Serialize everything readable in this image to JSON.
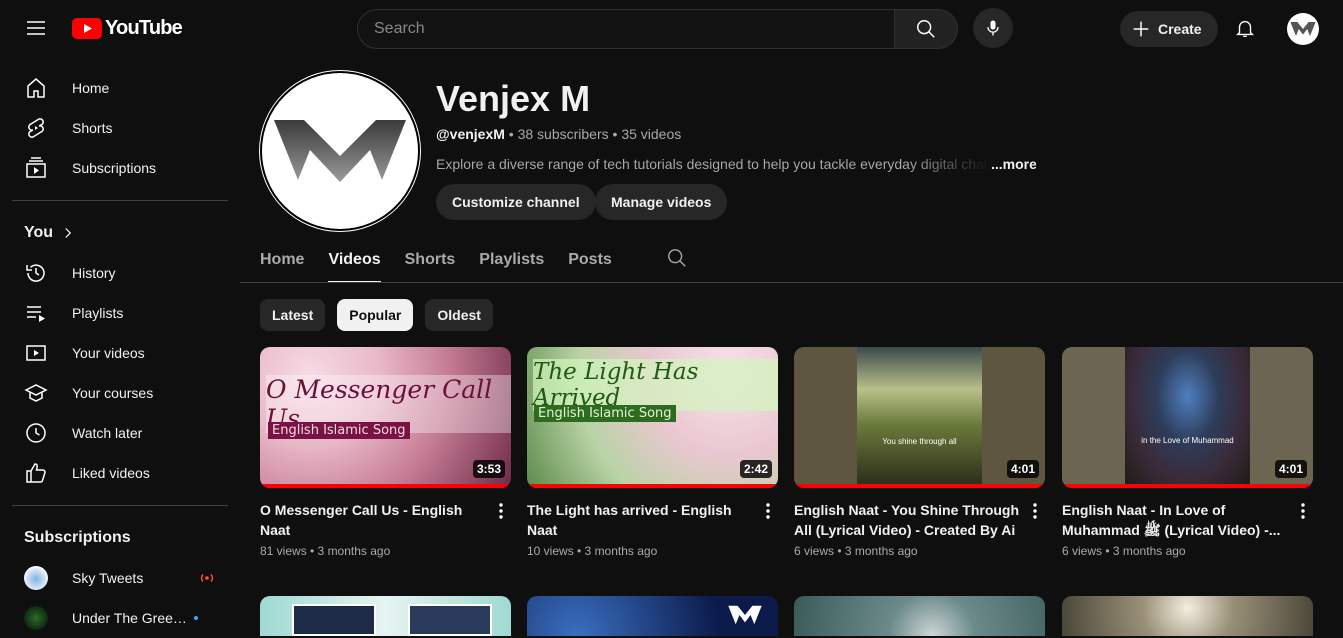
{
  "topbar": {
    "logo_text": "YouTube",
    "search_placeholder": "Search",
    "create_label": "Create"
  },
  "sidebar": {
    "main": [
      {
        "label": "Home",
        "icon": "home-icon"
      },
      {
        "label": "Shorts",
        "icon": "shorts-icon"
      },
      {
        "label": "Subscriptions",
        "icon": "subscriptions-icon"
      }
    ],
    "you_label": "You",
    "you_items": [
      {
        "label": "History",
        "icon": "history-icon"
      },
      {
        "label": "Playlists",
        "icon": "playlists-icon"
      },
      {
        "label": "Your videos",
        "icon": "your-videos-icon"
      },
      {
        "label": "Your courses",
        "icon": "courses-icon"
      },
      {
        "label": "Watch later",
        "icon": "watch-later-icon"
      },
      {
        "label": "Liked videos",
        "icon": "like-icon"
      }
    ],
    "subscriptions_label": "Subscriptions",
    "subscriptions": [
      {
        "name": "Sky Tweets",
        "status": "live"
      },
      {
        "name": "Under The Green...",
        "status": "new"
      }
    ]
  },
  "channel": {
    "name": "Venjex M",
    "handle": "@venjexM",
    "subscribers": "38 subscribers",
    "videos_count": "35 videos",
    "separator": "•",
    "description": "Explore a diverse range of tech tutorials designed to help you tackle everyday digital chall",
    "more_label": "...more",
    "customize_label": "Customize channel",
    "manage_label": "Manage videos"
  },
  "tabs": [
    "Home",
    "Videos",
    "Shorts",
    "Playlists",
    "Posts"
  ],
  "active_tab": "Videos",
  "chips": [
    "Latest",
    "Popular",
    "Oldest"
  ],
  "selected_chip": "Popular",
  "videos": [
    {
      "title": "O Messenger Call Us - English Naat",
      "meta": "81 views • 3 months ago",
      "duration": "3:53",
      "thumb_title": "O Messenger Call Us",
      "thumb_sub": "English Islamic Song"
    },
    {
      "title": "The Light has arrived - English Naat",
      "meta": "10 views • 3 months ago",
      "duration": "2:42",
      "thumb_title": "The Light Has Arrived",
      "thumb_sub": "English Islamic Song"
    },
    {
      "title": "English Naat - You Shine Through All (Lyrical Video) - Created By Ai",
      "meta": "6 views • 3 months ago",
      "duration": "4:01",
      "thumb_caption": "You shine through all"
    },
    {
      "title": "English Naat - In Love of Muhammad ﷺ (Lyrical Video) -...",
      "meta": "6 views • 3 months ago",
      "duration": "4:01",
      "thumb_caption": "in the Love of Muhammad"
    }
  ],
  "colors": {
    "background": "#0f0f0f",
    "chip": "#272727",
    "progress": "#ff0000",
    "brand_red": "#ff0000"
  }
}
